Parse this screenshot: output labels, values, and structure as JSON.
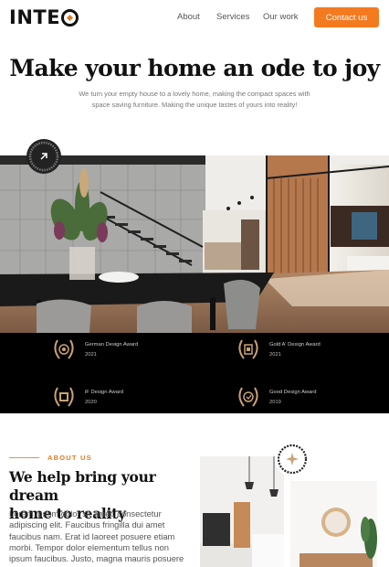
{
  "header": {
    "logo_text": "INTEO",
    "nav": [
      {
        "label": "About"
      },
      {
        "label": "Services"
      },
      {
        "label": "Our work"
      }
    ],
    "contact_label": "Contact us"
  },
  "hero": {
    "title": "Make your home an ode to joy",
    "subtitle_line1": "We turn your empty house to a lovely home, making the compact spaces with",
    "subtitle_line2": "space saving furniture. Making the unique tastes of yours into reality!",
    "badge_text": "GET IN TOUCH · CONTACT US"
  },
  "awards": [
    {
      "name": "German Design Award",
      "year": "2021"
    },
    {
      "name": "Gold A' Design Award",
      "year": "2021"
    },
    {
      "name": "iF Design Award",
      "year": "2020"
    },
    {
      "name": "Good Design Award",
      "year": "2019"
    }
  ],
  "about": {
    "label": "ABOUT US",
    "title_line1": "We help bring your dream",
    "title_line2": "home to reality",
    "body_lines": [
      "Lorem ipsum dolor sit amet, consectetur",
      "adipiscing elit. Faucibus fringilla dui amet",
      "faucibus nam. Erat id laoreet posuere etiam",
      "morbi. Tempor dolor elementum tellus non",
      "ipsum faucibus. Justo, magna mauris posuere"
    ],
    "stamp_text": "DESIGN · STUDIO · AWARD · WINNING"
  },
  "colors": {
    "accent": "#f47a20",
    "dark": "#000000",
    "text": "#111111",
    "muted": "#777777"
  }
}
